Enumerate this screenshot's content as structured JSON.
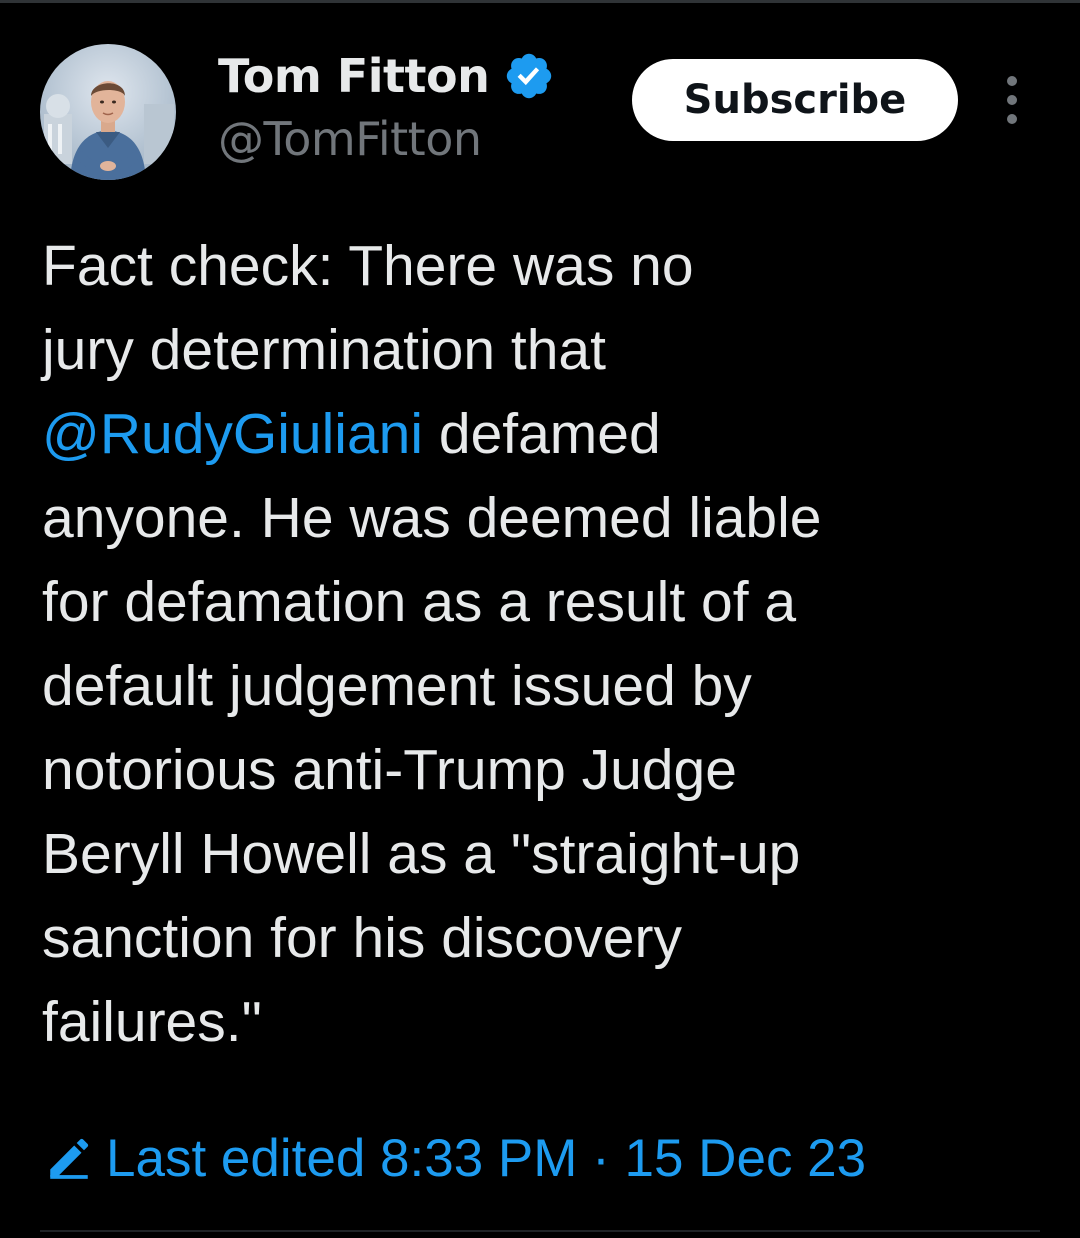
{
  "author": {
    "display_name": "Tom Fitton",
    "handle": "@TomFitton",
    "verified": true,
    "avatar_icon": "profile-photo"
  },
  "header": {
    "subscribe_label": "Subscribe",
    "more_icon": "vertical-ellipsis-icon"
  },
  "tweet": {
    "lines": [
      {
        "text": "Fact check: There was no"
      },
      {
        "text": "jury determination that"
      },
      {
        "mention": "@RudyGiuliani",
        "text": " defamed"
      },
      {
        "text": "anyone. He was deemed liable"
      },
      {
        "text": "for defamation as a result of a"
      },
      {
        "text": "default judgement issued by"
      },
      {
        "text": "notorious anti-Trump Judge"
      },
      {
        "text": "Beryll Howell as a \"straight-up"
      },
      {
        "text": "sanction for his discovery"
      },
      {
        "text": "failures.\""
      }
    ]
  },
  "edited": {
    "icon": "pencil-edit-icon",
    "text": "Last edited 8:33 PM · 15 Dec 23"
  },
  "colors": {
    "background": "#000000",
    "text_primary": "#e7e9ea",
    "text_secondary": "#71767b",
    "accent_blue": "#1d9bf0",
    "button_bg": "#ffffff"
  }
}
